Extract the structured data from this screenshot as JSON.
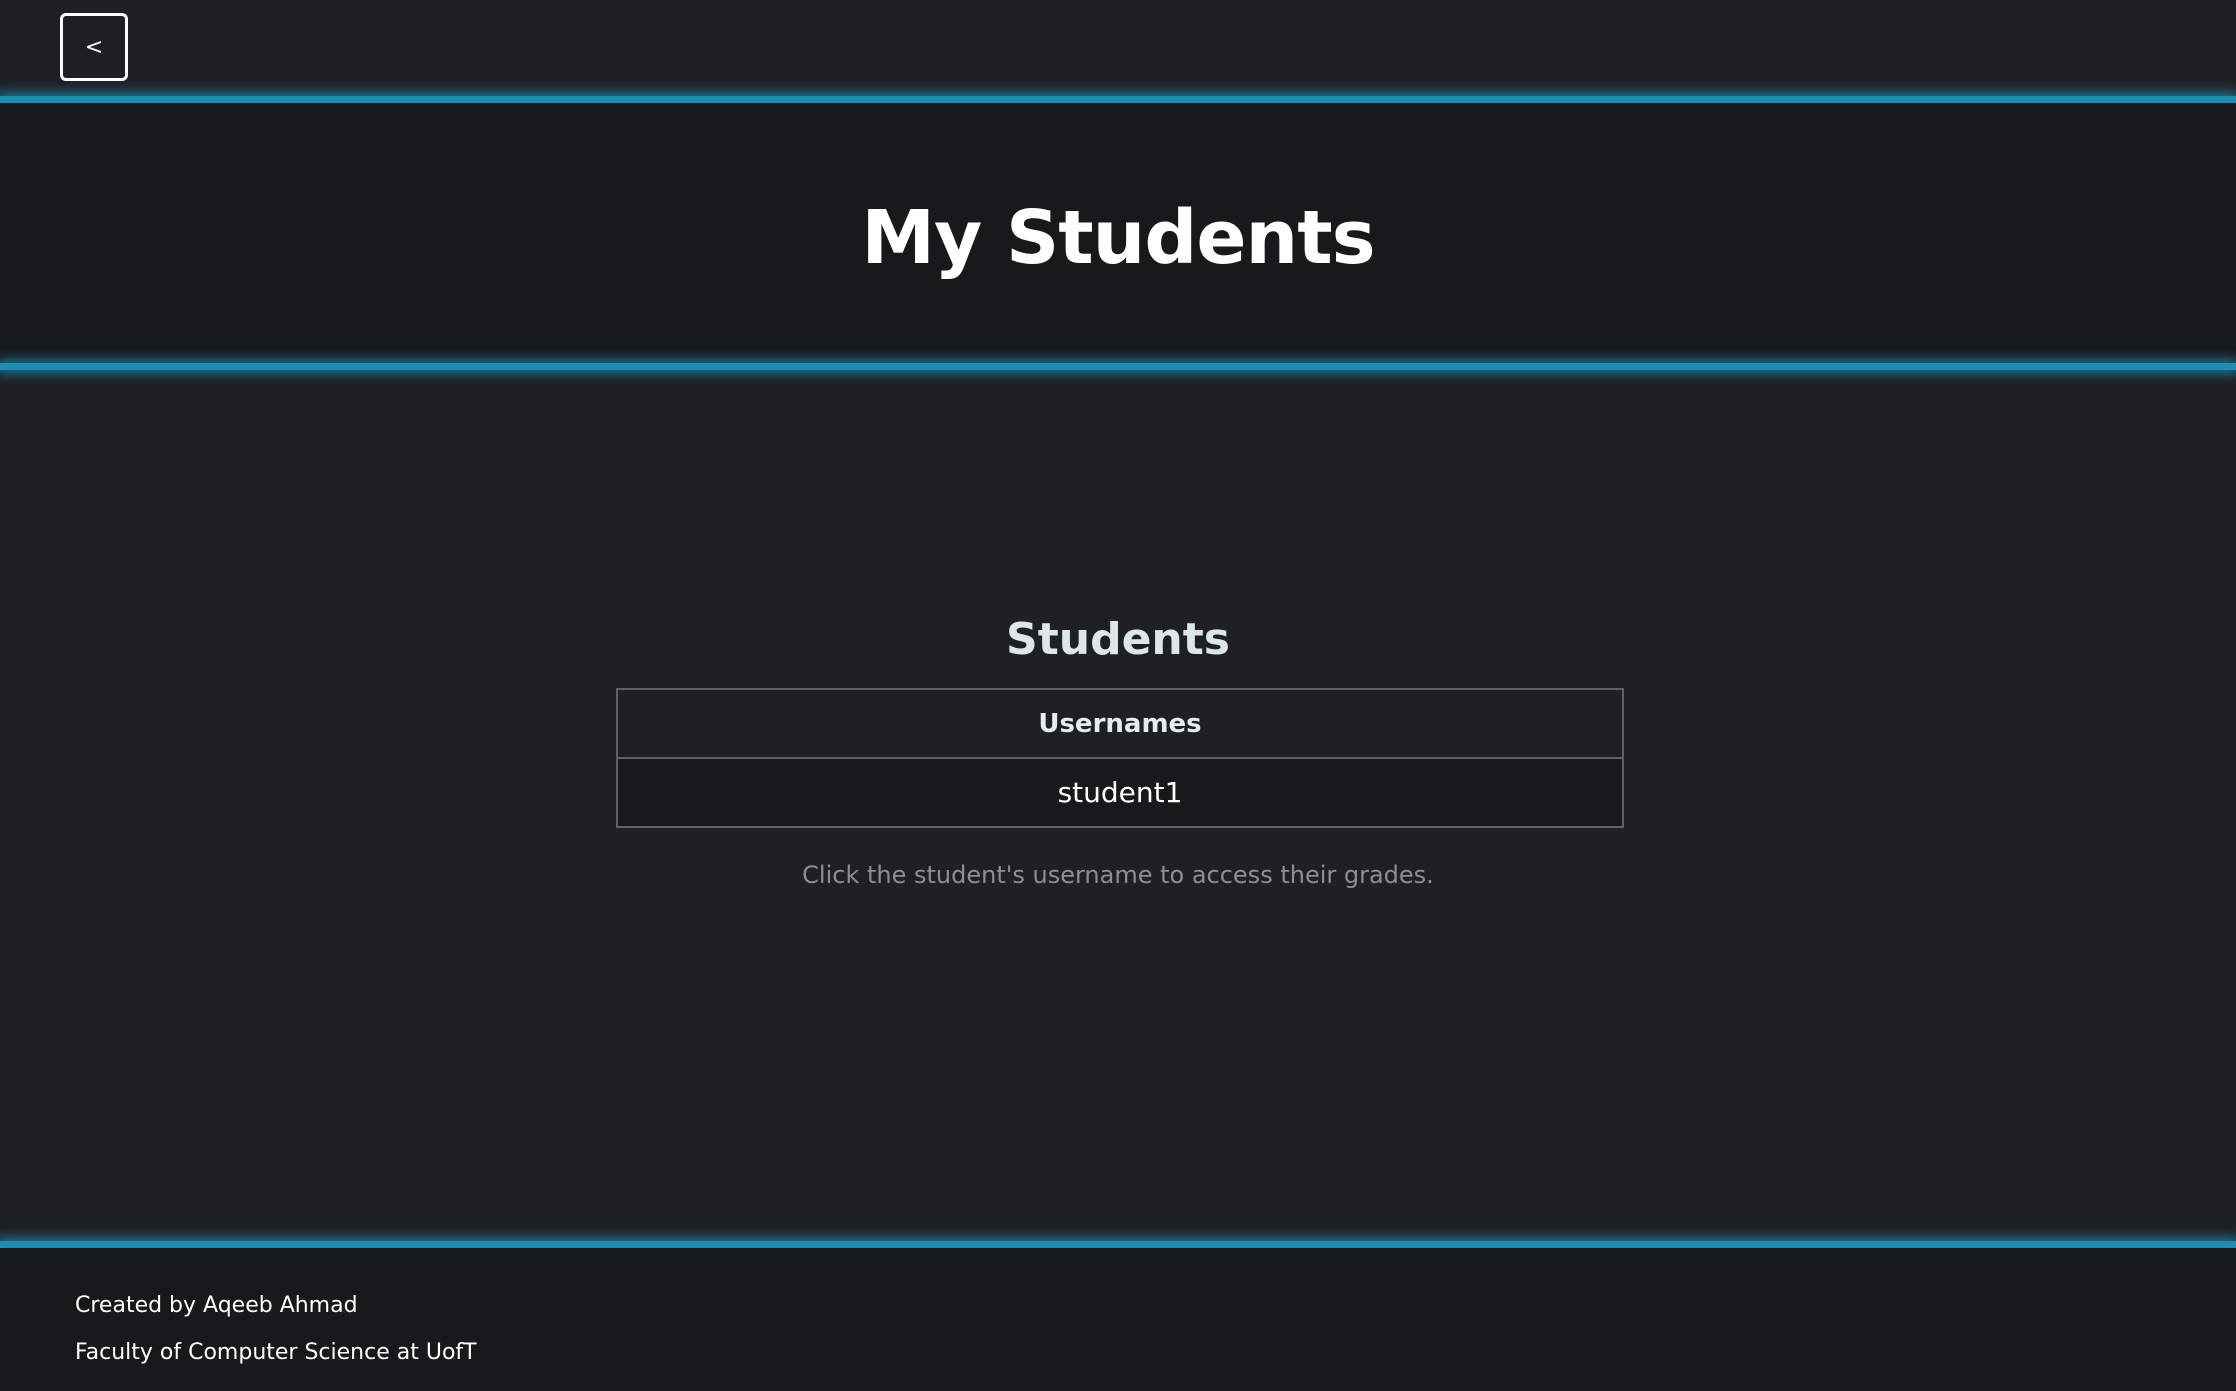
{
  "nav": {
    "back_label": "<"
  },
  "header": {
    "title": "My Students"
  },
  "main": {
    "section_title": "Students",
    "table": {
      "columns": [
        "Usernames"
      ],
      "rows": [
        [
          "student1"
        ]
      ]
    },
    "hint": "Click the student's username to access their grades."
  },
  "footer": {
    "created_by": "Created by Aqeeb Ahmad",
    "faculty": "Faculty of Computer Science at UofT"
  },
  "colors": {
    "background": "#1f2023",
    "band": "#18191b",
    "accent_glow": "#1d8db3"
  }
}
